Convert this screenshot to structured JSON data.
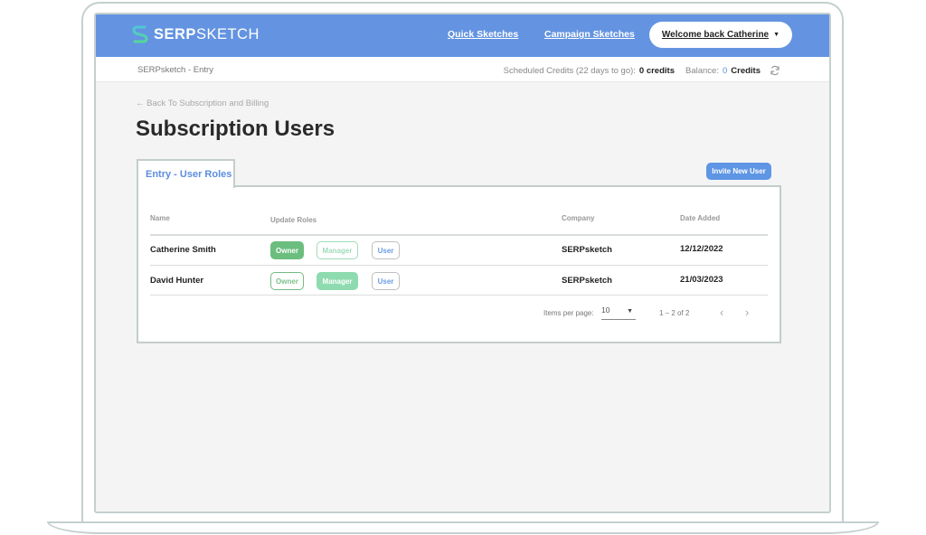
{
  "header": {
    "logo_bold": "SERP",
    "logo_light": "SKETCH",
    "nav": [
      {
        "label": "Quick Sketches"
      },
      {
        "label": "Campaign Sketches"
      }
    ],
    "welcome_label": "Welcome back Catherine",
    "welcome_caret": "▼",
    "brand_color": "#6494e1"
  },
  "subbar": {
    "breadcrumb": "SERPsketch - Entry",
    "scheduled_label": "Scheduled Credits (22 days to go):",
    "scheduled_value": "0 credits",
    "balance_label": "Balance:",
    "balance_number": "0",
    "balance_unit": "Credits"
  },
  "page": {
    "back_link": "← Back To Subscription and Billing",
    "title": "Subscription Users",
    "tab_label": "Entry - User Roles",
    "invite_button": "Invite New User"
  },
  "table": {
    "columns": [
      "Name",
      "Update Roles",
      "Company",
      "Date Added"
    ],
    "rows": [
      {
        "name": "Catherine Smith",
        "roles": {
          "owner": "Owner",
          "manager": "Manager",
          "user": "User"
        },
        "active_role": "Owner",
        "company": "SERPsketch",
        "date": "12/12/2022"
      },
      {
        "name": "David Hunter",
        "roles": {
          "owner": "Owner",
          "manager": "Manager",
          "user": "User"
        },
        "active_role": "Manager",
        "company": "SERPsketch",
        "date": "21/03/2023"
      }
    ]
  },
  "pagination": {
    "items_per_page_label": "Items per page:",
    "items_per_page": "10",
    "range": "1 – 2 of 2",
    "prev": "‹",
    "next": "›"
  }
}
